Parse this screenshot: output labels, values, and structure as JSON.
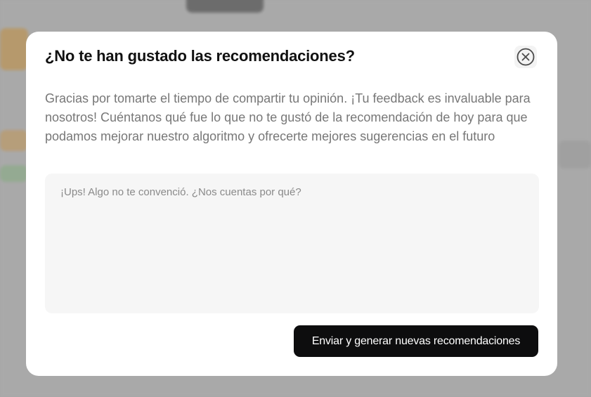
{
  "modal": {
    "title": "¿No te han gustado las recomendaciones?",
    "description": "Gracias por tomarte el tiempo de compartir tu opinión. ¡Tu feedback es invaluable para nosotros! Cuéntanos qué fue lo que no te gustó de la recomendación de hoy para que podamos mejorar nuestro algoritmo y ofrecerte mejores sugerencias en el futuro",
    "feedback_placeholder": "¡Ups! Algo no te convenció. ¿Nos cuentas por qué?",
    "feedback_value": "",
    "submit_label": "Enviar y generar nuevas recomendaciones",
    "close_icon": "close-circle-icon"
  },
  "colors": {
    "modal_bg": "#ffffff",
    "button_bg": "#0d0d0e",
    "input_bg": "#f6f6f6",
    "title": "#111111",
    "description": "#777777"
  }
}
